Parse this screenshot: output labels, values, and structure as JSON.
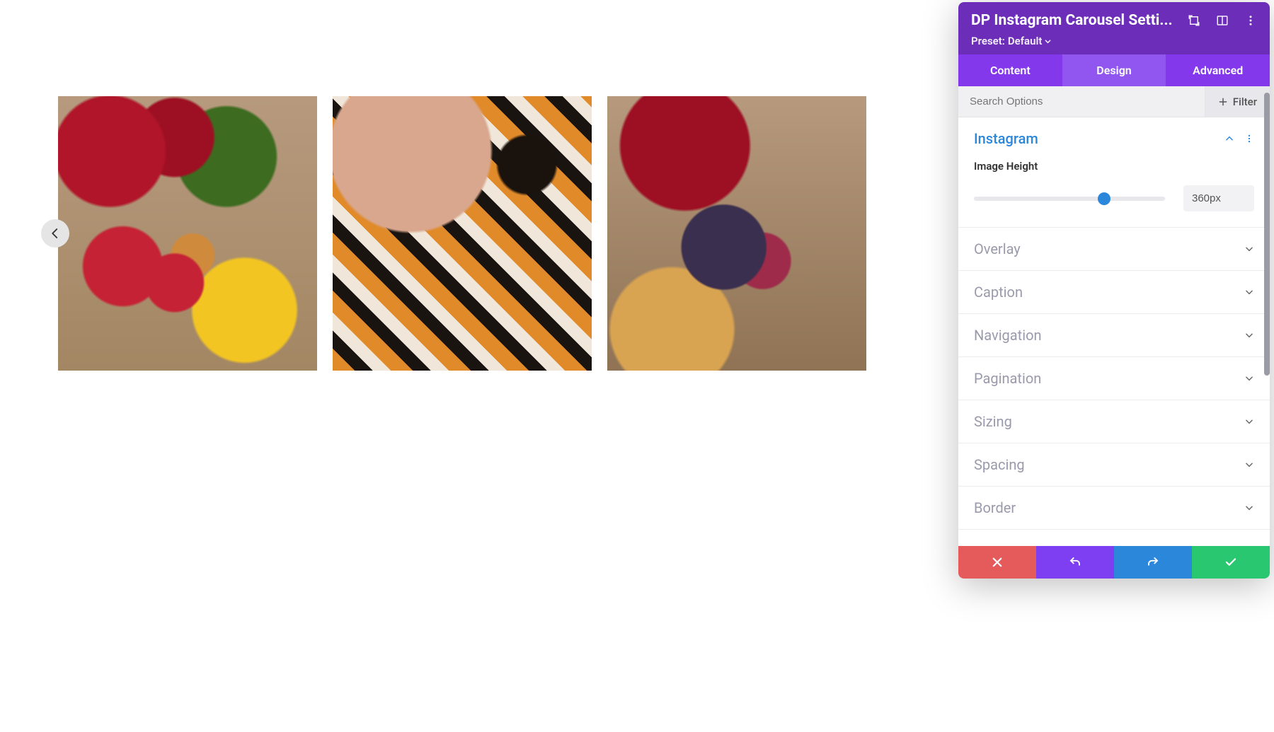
{
  "panel": {
    "title": "DP Instagram Carousel Setti...",
    "preset_label": "Preset:",
    "preset_value": "Default",
    "tabs": {
      "content": "Content",
      "design": "Design",
      "advanced": "Advanced",
      "active": "design"
    },
    "search_placeholder": "Search Options",
    "filter_label": "Filter"
  },
  "accordion": {
    "open_section": "instagram",
    "sections": [
      {
        "key": "instagram",
        "title": "Instagram"
      },
      {
        "key": "overlay",
        "title": "Overlay"
      },
      {
        "key": "caption",
        "title": "Caption"
      },
      {
        "key": "navigation",
        "title": "Navigation"
      },
      {
        "key": "pagination",
        "title": "Pagination"
      },
      {
        "key": "sizing",
        "title": "Sizing"
      },
      {
        "key": "spacing",
        "title": "Spacing"
      },
      {
        "key": "border",
        "title": "Border"
      }
    ]
  },
  "instagram": {
    "image_height_label": "Image Height",
    "image_height_value": "360px"
  },
  "colors": {
    "header": "#6c2eb9",
    "tabs": "#8338ec",
    "accent": "#2b87da",
    "cancel": "#e55a5a",
    "undo": "#7e3ff2",
    "redo": "#2b87da",
    "save": "#29c770"
  }
}
